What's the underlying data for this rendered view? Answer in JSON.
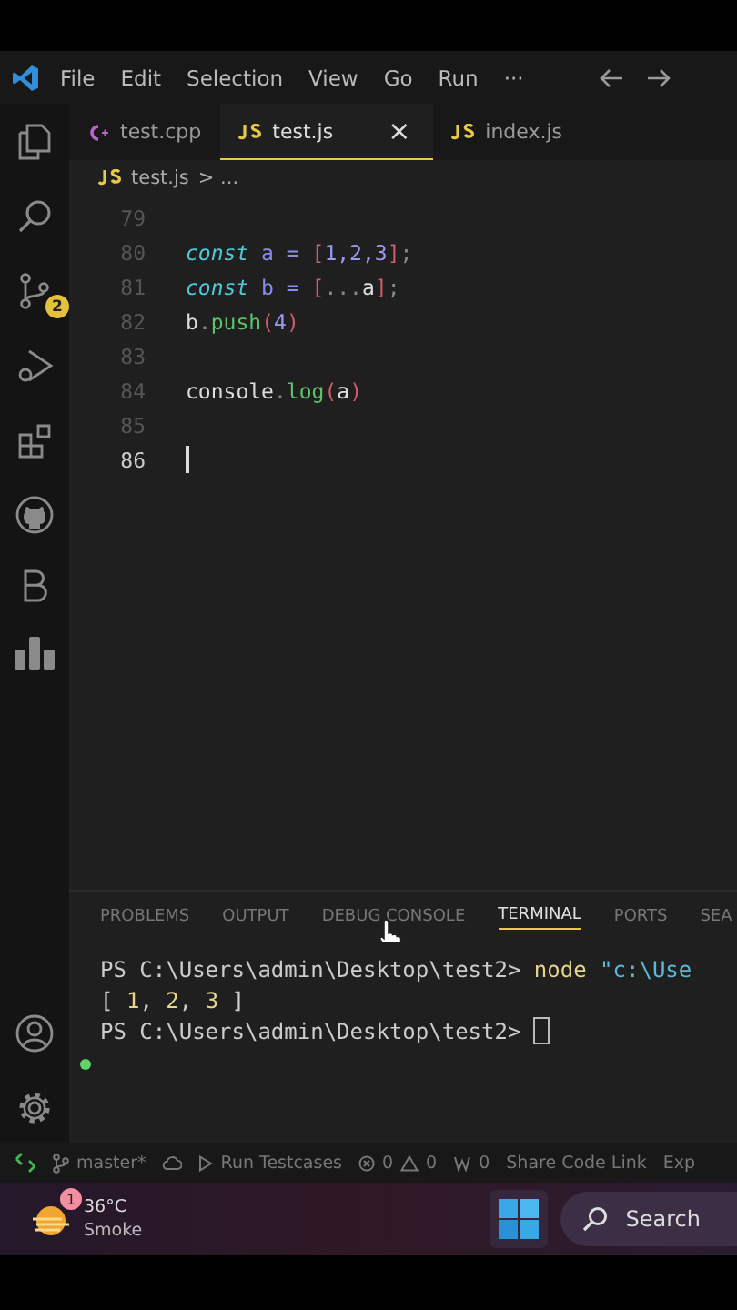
{
  "menu": [
    "File",
    "Edit",
    "Selection",
    "View",
    "Go",
    "Run",
    "···"
  ],
  "tabs": [
    {
      "label": "test.cpp",
      "kind": "cpp",
      "selected": false
    },
    {
      "label": "test.js",
      "kind": "js",
      "selected": true
    },
    {
      "label": "index.js",
      "kind": "js",
      "selected": false
    }
  ],
  "tab_close": "×",
  "breadcrumb": {
    "file": "test.js",
    "rest": "> ..."
  },
  "source_control_badge": "2",
  "code_lines": [
    {
      "number": "79",
      "current": false
    },
    {
      "number": "80",
      "current": false,
      "tokens": [
        {
          "t": "const",
          "kind": "keyword"
        },
        {
          "t": " a ",
          "kind": "variable"
        },
        {
          "t": "= ",
          "kind": "operator"
        },
        {
          "t": "[",
          "kind": "bracket"
        },
        {
          "t": "1,2,3",
          "kind": "number"
        },
        {
          "t": "]",
          "kind": "bracket"
        },
        {
          "t": ";",
          "kind": "punct"
        }
      ]
    },
    {
      "number": "81",
      "current": false,
      "tokens": [
        {
          "t": "const",
          "kind": "keyword"
        },
        {
          "t": " b ",
          "kind": "variable"
        },
        {
          "t": "= ",
          "kind": "operator"
        },
        {
          "t": "[",
          "kind": "bracket"
        },
        {
          "t": "...",
          "kind": "punct"
        },
        {
          "t": "a",
          "kind": "plain"
        },
        {
          "t": "]",
          "kind": "bracket"
        },
        {
          "t": ";",
          "kind": "punct"
        }
      ]
    },
    {
      "number": "82",
      "current": false,
      "tokens": [
        {
          "t": "b",
          "kind": "plain"
        },
        {
          "t": ".",
          "kind": "punct"
        },
        {
          "t": "push",
          "kind": "function"
        },
        {
          "t": "(",
          "kind": "bracket"
        },
        {
          "t": "4",
          "kind": "number"
        },
        {
          "t": ")",
          "kind": "bracket"
        }
      ]
    },
    {
      "number": "83",
      "current": false
    },
    {
      "number": "84",
      "current": false,
      "tokens": [
        {
          "t": "console",
          "kind": "plain"
        },
        {
          "t": ".",
          "kind": "punct"
        },
        {
          "t": "log",
          "kind": "function"
        },
        {
          "t": "(",
          "kind": "bracket"
        },
        {
          "t": "a",
          "kind": "plain"
        },
        {
          "t": ")",
          "kind": "bracket"
        }
      ]
    },
    {
      "number": "85",
      "current": false
    },
    {
      "number": "86",
      "current": true
    }
  ],
  "panel_tabs": [
    {
      "label": "PROBLEMS",
      "selected": false
    },
    {
      "label": "OUTPUT",
      "selected": false
    },
    {
      "label": "DEBUG CONSOLE",
      "selected": false
    },
    {
      "label": "TERMINAL",
      "selected": true
    },
    {
      "label": "PORTS",
      "selected": false
    },
    {
      "label": "SEA",
      "selected": false
    }
  ],
  "terminal_lines": [
    {
      "cursor": false,
      "parts": [
        {
          "t": "PS C:\\Users\\admin\\Desktop\\test2> ",
          "kind": "plain"
        },
        {
          "t": "node ",
          "kind": "command"
        },
        {
          "t": "\"c:\\Use",
          "kind": "string"
        }
      ]
    },
    {
      "cursor": false,
      "parts": [
        {
          "t": "[ ",
          "kind": "plain"
        },
        {
          "t": "1",
          "kind": "number"
        },
        {
          "t": ", ",
          "kind": "plain"
        },
        {
          "t": "2",
          "kind": "number"
        },
        {
          "t": ", ",
          "kind": "plain"
        },
        {
          "t": "3",
          "kind": "number"
        },
        {
          "t": " ]",
          "kind": "plain"
        }
      ]
    },
    {
      "cursor": true,
      "parts": [
        {
          "t": "PS C:\\Users\\admin\\Desktop\\test2> ",
          "kind": "plain"
        }
      ]
    }
  ],
  "status_bar": {
    "branch": "master*",
    "run": "Run Testcases",
    "errors": "0",
    "warnings": "0",
    "ports": "0",
    "share": "Share Code Link",
    "cut": "Exp"
  },
  "taskbar": {
    "weather_badge": "1",
    "temperature": "36°C",
    "condition": "Smoke",
    "search": "Search"
  }
}
